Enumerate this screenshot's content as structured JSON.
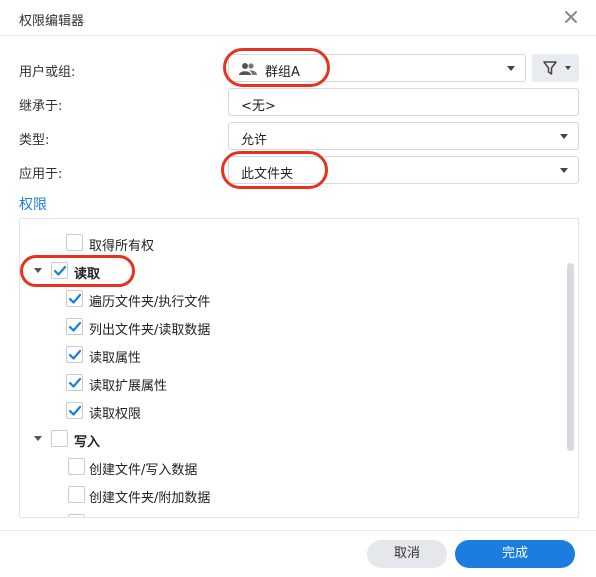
{
  "dialog": {
    "title": "权限编辑器",
    "close_icon": "close-icon"
  },
  "form": {
    "user_or_group": {
      "label": "用户或组:",
      "value": "群组A",
      "icon": "group-icon"
    },
    "inherit_from": {
      "label": "继承于:",
      "value": "<无>"
    },
    "type": {
      "label": "类型:",
      "value": "允许"
    },
    "apply_to": {
      "label": "应用于:",
      "value": "此文件夹"
    },
    "filter_icon": "filter-icon"
  },
  "permissions": {
    "title": "权限",
    "items": [
      {
        "label": "取得所有权",
        "checked": false,
        "level": 1
      },
      {
        "label": "读取",
        "checked": true,
        "level": 0,
        "group": true,
        "expanded": true
      },
      {
        "label": "遍历文件夹/执行文件",
        "checked": true,
        "level": 1
      },
      {
        "label": "列出文件夹/读取数据",
        "checked": true,
        "level": 1
      },
      {
        "label": "读取属性",
        "checked": true,
        "level": 1
      },
      {
        "label": "读取扩展属性",
        "checked": true,
        "level": 1
      },
      {
        "label": "读取权限",
        "checked": true,
        "level": 1
      },
      {
        "label": "写入",
        "checked": false,
        "level": 0,
        "group": true,
        "expanded": true
      },
      {
        "label": "创建文件/写入数据",
        "checked": false,
        "level": 1
      },
      {
        "label": "创建文件夹/附加数据",
        "checked": false,
        "level": 1
      }
    ]
  },
  "footer": {
    "cancel_label": "取消",
    "done_label": "完成"
  },
  "colors": {
    "accent": "#1a7ddf",
    "highlight": "#e8321e"
  }
}
